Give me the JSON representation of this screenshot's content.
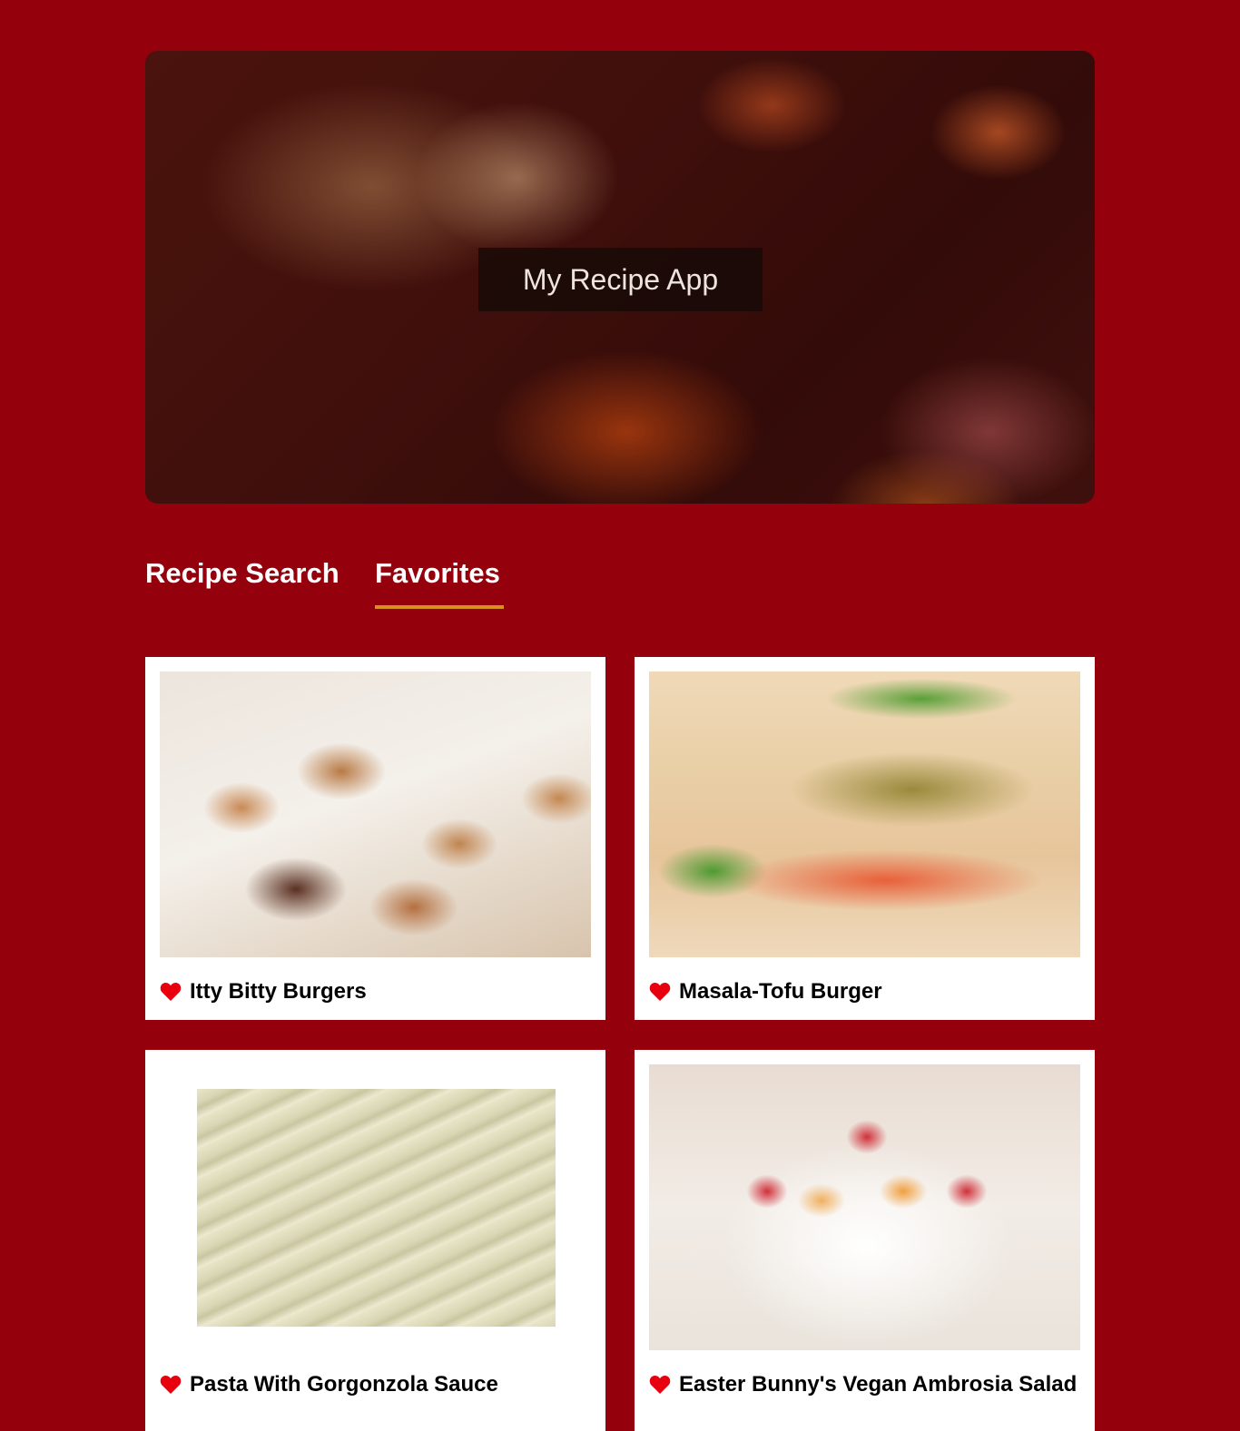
{
  "app": {
    "title": "My Recipe App"
  },
  "tabs": [
    {
      "label": "Recipe Search",
      "active": false
    },
    {
      "label": "Favorites",
      "active": true
    }
  ],
  "accent_color": "#d9901c",
  "background_color": "#94000b",
  "favorites": [
    {
      "title": "Itty Bitty Burgers",
      "favorited": true,
      "icon": "heart-icon"
    },
    {
      "title": "Masala-Tofu Burger",
      "favorited": true,
      "icon": "heart-icon"
    },
    {
      "title": "Pasta With Gorgonzola Sauce",
      "favorited": true,
      "icon": "heart-icon"
    },
    {
      "title": "Easter Bunny's Vegan Ambrosia Salad",
      "favorited": true,
      "icon": "heart-icon"
    }
  ]
}
